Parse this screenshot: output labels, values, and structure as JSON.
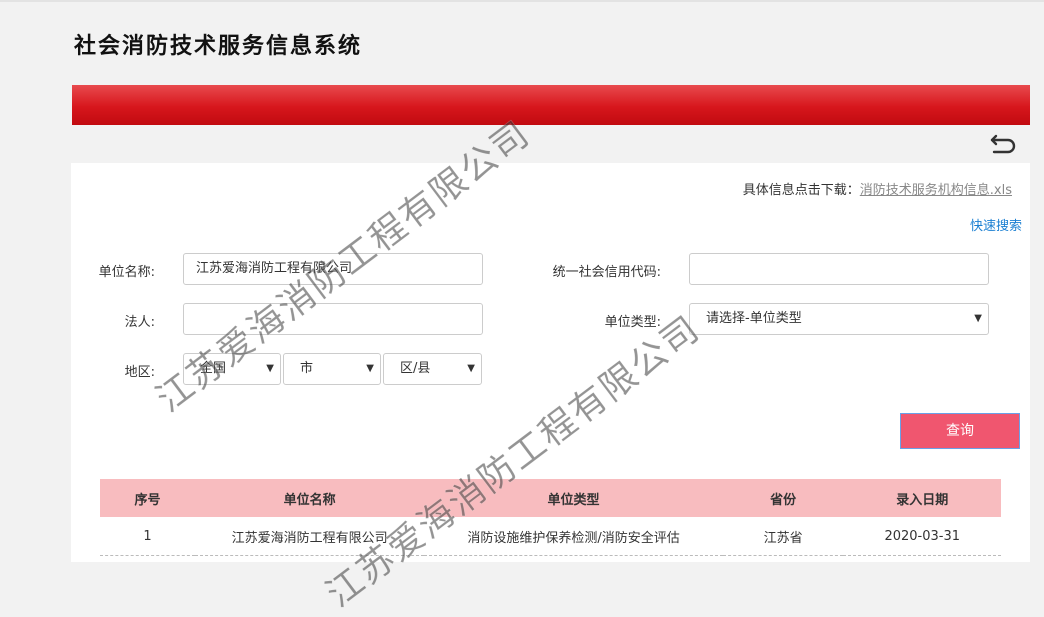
{
  "header": {
    "title": "社会消防技术服务信息系统"
  },
  "download": {
    "prefix": "具体信息点击下载：",
    "link": "消防技术服务机构信息.xls"
  },
  "quick_search": "快速搜索",
  "form": {
    "unit_name_label": "单位名称:",
    "unit_name_value": "江苏爱海消防工程有限公司",
    "credit_code_label": "统一社会信用代码:",
    "credit_code_value": "",
    "legal_label": "法人:",
    "legal_value": "",
    "unit_type_label": "单位类型:",
    "unit_type_value": "请选择-单位类型",
    "region_label": "地区:",
    "province_value": "全国",
    "city_value": "市",
    "district_value": "区/县"
  },
  "query_button": "查询",
  "table": {
    "headers": [
      "序号",
      "单位名称",
      "单位类型",
      "省份",
      "录入日期"
    ],
    "rows": [
      [
        "1",
        "江苏爱海消防工程有限公司",
        "消防设施维护保养检测/消防安全评估",
        "江苏省",
        "2020-03-31"
      ]
    ]
  },
  "watermark": "江苏爱海消防工程有限公司",
  "icons": {
    "back": "back-arrow-icon",
    "dropdown": "chevron-down-icon"
  }
}
